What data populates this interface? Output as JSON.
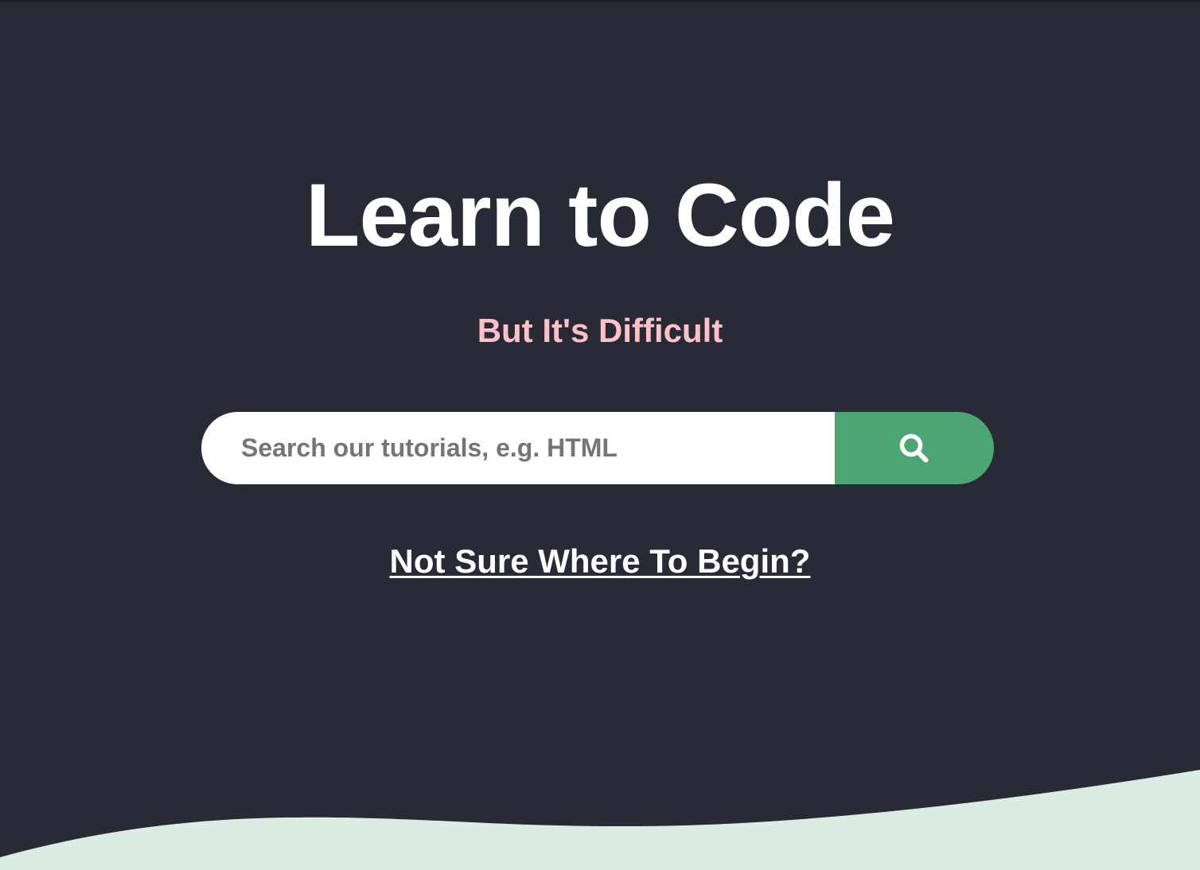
{
  "hero": {
    "title": "Learn to Code",
    "subtitle": "But It's Difficult",
    "search": {
      "placeholder": "Search our tutorials, e.g. HTML",
      "value": "",
      "button_icon": "search-icon"
    },
    "begin_link": "Not Sure Where To Begin?"
  },
  "colors": {
    "background": "#282a35",
    "title": "#ffffff",
    "subtitle": "#ffc0c7",
    "search_button": "#4ca674",
    "wave": "#dbede2"
  }
}
